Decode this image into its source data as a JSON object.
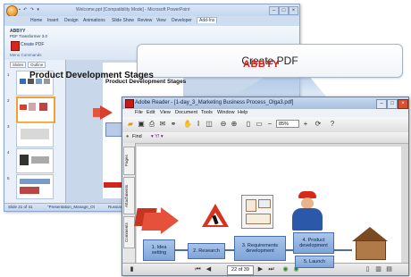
{
  "ppt": {
    "title": "Welcome.ppt [Compatibility Mode] - Microsoft PowerPoint",
    "qat": "▪ ↶ ↷ ▾",
    "tabs": [
      "Home",
      "Insert",
      "Design",
      "Animations",
      "Slide Show",
      "Review",
      "View",
      "Developer",
      "Add-Ins"
    ],
    "ribbon": {
      "product_name": "ABBYY",
      "product_sub": "PDF Transformer 3.0",
      "create_pdf_label": "Create PDF",
      "group_label": "Menu Commands"
    },
    "left_tabs": [
      "Slides",
      "Outline"
    ],
    "slide_numbers": [
      "1",
      "2",
      "3",
      "4",
      "5"
    ],
    "slide_title": "Product Development Stages",
    "status": {
      "slide_counter": "Slide 21 of 41",
      "template": "\"Presentation_Manage_Ot",
      "language": "Russian"
    }
  },
  "callout": {
    "label": "Create PDF"
  },
  "reader": {
    "title": "Adobe Reader - [1-day_3_Marketing Business Process_Olga3.pdf]",
    "menu": [
      "File",
      "Edit",
      "View",
      "Document",
      "Tools",
      "Window",
      "Help"
    ],
    "zoom": "85%",
    "find_label": "Find",
    "search_web_label": "▾ Y! ▾",
    "nav_tabs": [
      "Pages",
      "Attachments",
      "Comments"
    ],
    "page_title": "Product Development Stages",
    "logo": "ABBYY",
    "page_indicator": "22 of 39",
    "diagram": {
      "stages": [
        "1. Idea setting",
        "2. Research",
        "3. Requirements development",
        "4. Product development",
        "5. Launch"
      ]
    }
  },
  "colors": {
    "abbyy_red": "#d41f18",
    "stage_box": "#8fb0de",
    "ribbon_bg": "#dbe6f4"
  }
}
